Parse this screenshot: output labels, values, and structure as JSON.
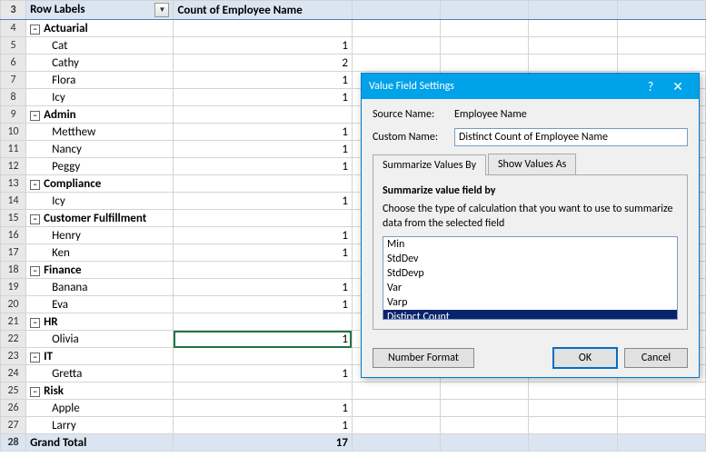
{
  "pivot": {
    "header_label": "Row Labels",
    "value_header": "Count of Employee Name",
    "rows": [
      {
        "n": 3,
        "type": "header"
      },
      {
        "n": 4,
        "type": "group",
        "label": "Actuarial"
      },
      {
        "n": 5,
        "type": "item",
        "label": "Cat",
        "val": 1
      },
      {
        "n": 6,
        "type": "item",
        "label": "Cathy",
        "val": 2
      },
      {
        "n": 7,
        "type": "item",
        "label": "Flora",
        "val": 1
      },
      {
        "n": 8,
        "type": "item",
        "label": "Icy",
        "val": 1
      },
      {
        "n": 9,
        "type": "group",
        "label": "Admin"
      },
      {
        "n": 10,
        "type": "item",
        "label": "Metthew",
        "val": 1
      },
      {
        "n": 11,
        "type": "item",
        "label": "Nancy",
        "val": 1
      },
      {
        "n": 12,
        "type": "item",
        "label": "Peggy",
        "val": 1
      },
      {
        "n": 13,
        "type": "group",
        "label": "Compliance"
      },
      {
        "n": 14,
        "type": "item",
        "label": "Icy",
        "val": 1
      },
      {
        "n": 15,
        "type": "group",
        "label": "Customer Fulfillment"
      },
      {
        "n": 16,
        "type": "item",
        "label": "Henry",
        "val": 1
      },
      {
        "n": 17,
        "type": "item",
        "label": "Ken",
        "val": 1
      },
      {
        "n": 18,
        "type": "group",
        "label": "Finance"
      },
      {
        "n": 19,
        "type": "item",
        "label": "Banana",
        "val": 1
      },
      {
        "n": 20,
        "type": "item",
        "label": "Eva",
        "val": 1
      },
      {
        "n": 21,
        "type": "group",
        "label": "HR"
      },
      {
        "n": 22,
        "type": "item",
        "label": "Olivia",
        "val": 1,
        "selected": true
      },
      {
        "n": 23,
        "type": "group",
        "label": "IT"
      },
      {
        "n": 24,
        "type": "item",
        "label": "Gretta",
        "val": 1
      },
      {
        "n": 25,
        "type": "group",
        "label": "Risk"
      },
      {
        "n": 26,
        "type": "item",
        "label": "Apple",
        "val": 1
      },
      {
        "n": 27,
        "type": "item",
        "label": "Larry",
        "val": 1
      },
      {
        "n": 28,
        "type": "total",
        "label": "Grand Total",
        "val": 17
      }
    ]
  },
  "dialog": {
    "title": "Value Field Settings",
    "source_label": "Source Name:",
    "source_value": "Employee Name",
    "custom_label": "Custom Name:",
    "custom_value": "Distinct Count of Employee Name",
    "tab1": "Summarize Values By",
    "tab2": "Show Values As",
    "section": "Summarize value field by",
    "desc": "Choose the type of calculation that you want to use to summarize data from the selected field",
    "options": [
      "Min",
      "StdDev",
      "StdDevp",
      "Var",
      "Varp",
      "Distinct Count"
    ],
    "selected_option": "Distinct Count",
    "number_format": "Number Format",
    "ok": "OK",
    "cancel": "Cancel"
  }
}
